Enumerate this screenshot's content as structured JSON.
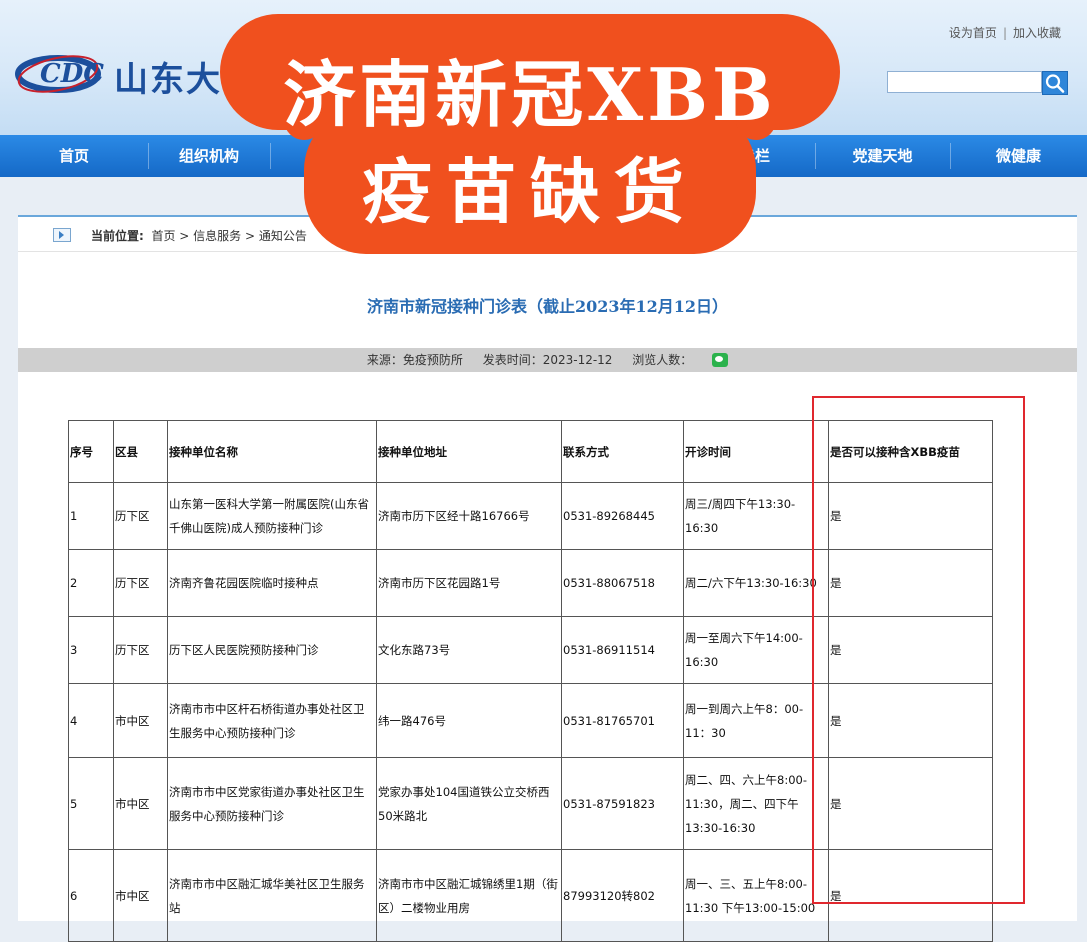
{
  "header": {
    "site_name": "山东大",
    "link_home": "设为首页",
    "link_separator": "|",
    "link_favorite": "加入收藏",
    "search_placeholder": "",
    "search_icon": "search-icon"
  },
  "nav": {
    "items": [
      {
        "label": "首页"
      },
      {
        "label": "组织机构"
      },
      {
        "label": ""
      },
      {
        "label": ""
      },
      {
        "label": ""
      },
      {
        "label": ""
      },
      {
        "label": "教专栏"
      },
      {
        "label": "党建天地"
      },
      {
        "label": "微健康"
      }
    ]
  },
  "overlay": {
    "line1": "济南新冠XBB",
    "line2": "疫苗缺货",
    "color": "#f0501e"
  },
  "breadcrumb": {
    "label": "当前位置:",
    "path": "首页 > 信息服务 > 通知公告"
  },
  "article": {
    "title": "济南市新冠接种门诊表（截止2023年12月12日）",
    "source": "来源：免疫预防所",
    "publish_time": "发表时间：2023-12-12",
    "views": "浏览人数：",
    "share_icon": "wechat-icon"
  },
  "table": {
    "headers": [
      "序号",
      "区县",
      "接种单位名称",
      "接种单位地址",
      "联系方式",
      "开诊时间",
      "是否可以接种含XBB疫苗"
    ],
    "rows": [
      {
        "no": "1",
        "district": "历下区",
        "name": "山东第一医科大学第一附属医院(山东省千佛山医院)成人预防接种门诊",
        "address": "济南市历下区经十路16766号",
        "phone": "0531-89268445",
        "hours": "周三/周四下午13:30-16:30",
        "xbb": "是"
      },
      {
        "no": "2",
        "district": "历下区",
        "name": "济南齐鲁花园医院临时接种点",
        "address": "济南市历下区花园路1号",
        "phone": "0531-88067518",
        "hours": "周二/六下午13:30-16:30",
        "xbb": "是"
      },
      {
        "no": "3",
        "district": "历下区",
        "name": "历下区人民医院预防接种门诊",
        "address": "文化东路73号",
        "phone": "0531-86911514",
        "hours": "周一至周六下午14:00-16:30",
        "xbb": "是"
      },
      {
        "no": "4",
        "district": "市中区",
        "name": "济南市市中区杆石桥街道办事处社区卫生服务中心预防接种门诊",
        "address": "纬一路476号",
        "phone": "0531-81765701",
        "hours": "周一到周六上午8：00-11：30",
        "xbb": "是"
      },
      {
        "no": "5",
        "district": "市中区",
        "name": "济南市市中区党家街道办事处社区卫生服务中心预防接种门诊",
        "address": "党家办事处104国道铁公立交桥西50米路北",
        "phone": "0531-87591823",
        "hours": "周二、四、六上午8:00-11:30，周二、四下午13:30-16:30",
        "xbb": "是"
      },
      {
        "no": "6",
        "district": "市中区",
        "name": "济南市市中区融汇城华美社区卫生服务站",
        "address": "济南市市中区融汇城锦绣里1期（街区）二楼物业用房",
        "phone": "87993120转802",
        "hours": "周一、三、五上午8:00-11:30 下午13:00-15:00",
        "xbb": "是"
      }
    ]
  }
}
